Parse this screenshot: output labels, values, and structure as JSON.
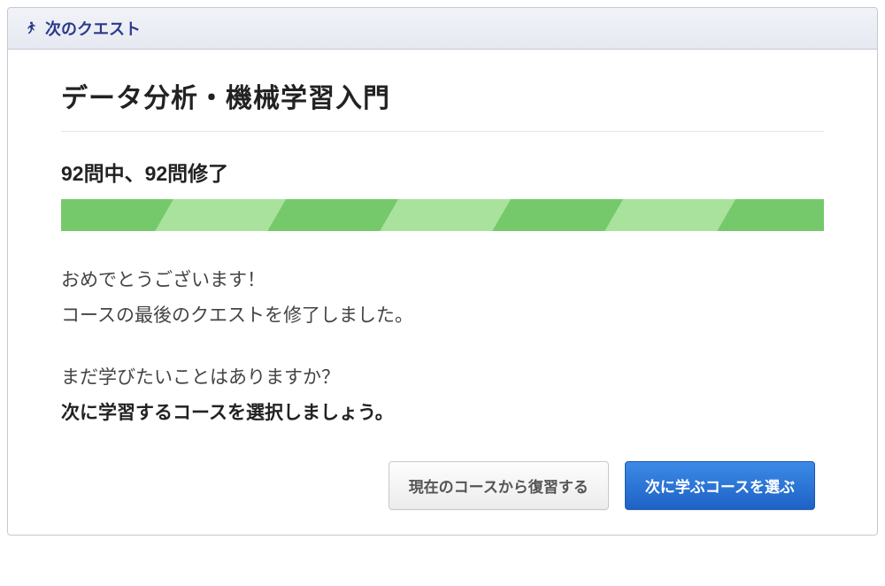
{
  "header": {
    "title": "次のクエスト"
  },
  "course": {
    "title": "データ分析・機械学習入門"
  },
  "progress": {
    "label": "92問中、92問修了",
    "total": 92,
    "completed": 92
  },
  "messages": {
    "congrats_line1": "おめでとうございます！",
    "congrats_line2": "コースの最後のクエストを修了しました。",
    "prompt_line1": "まだ学びたいことはありますか？",
    "prompt_line2": "次に学習するコースを選択しましょう。"
  },
  "buttons": {
    "review_current": "現在のコースから復習する",
    "choose_next": "次に学ぶコースを選ぶ"
  },
  "colors": {
    "header_text": "#2a3a8a",
    "progress_green_dark": "#76c96a",
    "progress_green_light": "#a9e29c",
    "primary_blue": "#1e62c6"
  }
}
